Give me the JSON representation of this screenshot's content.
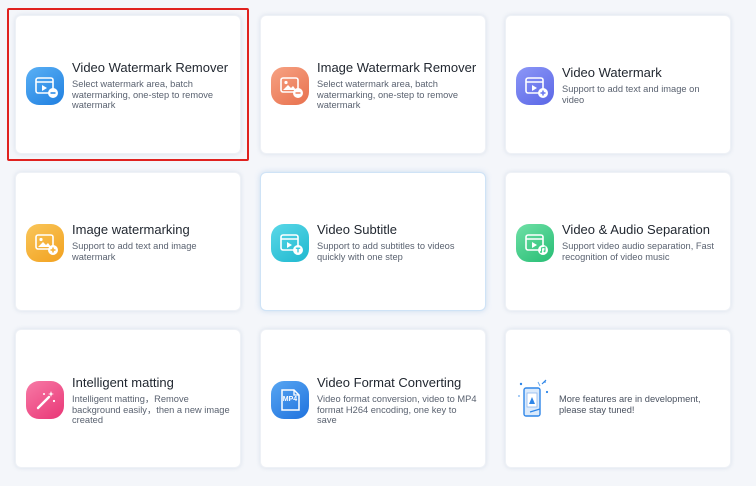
{
  "colors": {
    "selection": "#e0221f",
    "blue": "#2f8de8",
    "orange": "#ef8a6a",
    "violet": "#6e7cf0",
    "yellow": "#f6b43a",
    "cyan": "#2ec9dc",
    "green": "#3fcf8a",
    "pink": "#f0508a",
    "mp4blue": "#2f86e8"
  },
  "cards": [
    {
      "title": "Video Watermark Remover",
      "desc": "Select watermark area, batch watermarking, one-step to remove watermark",
      "icon": "video-eraser-icon"
    },
    {
      "title": "Image Watermark Remover",
      "desc": "Select watermark area, batch watermarking, one-step to remove watermark",
      "icon": "image-eraser-icon"
    },
    {
      "title": "Video Watermark",
      "desc": "Support to add text and image on video",
      "icon": "video-add-icon"
    },
    {
      "title": "Image watermarking",
      "desc": "Support to add text and image watermark",
      "icon": "image-add-icon"
    },
    {
      "title": "Video Subtitle",
      "desc": "Support to add subtitles to videos quickly with one step",
      "icon": "video-text-icon"
    },
    {
      "title": "Video & Audio Separation",
      "desc": "Support video audio separation, Fast recognition of video music",
      "icon": "video-audio-icon"
    },
    {
      "title": "Intelligent matting",
      "desc": "Intelligent matting，Remove background easily，then a new image created",
      "icon": "magic-wand-icon"
    },
    {
      "title": "Video Format Converting",
      "desc": "Video format conversion, video to MP4 format H264 encoding, one key to save",
      "icon": "mp4-file-icon",
      "icon_text": "MP4"
    },
    {
      "title": "",
      "desc": "More features are in development, please stay tuned!",
      "icon": "rocket-phone-icon"
    }
  ]
}
